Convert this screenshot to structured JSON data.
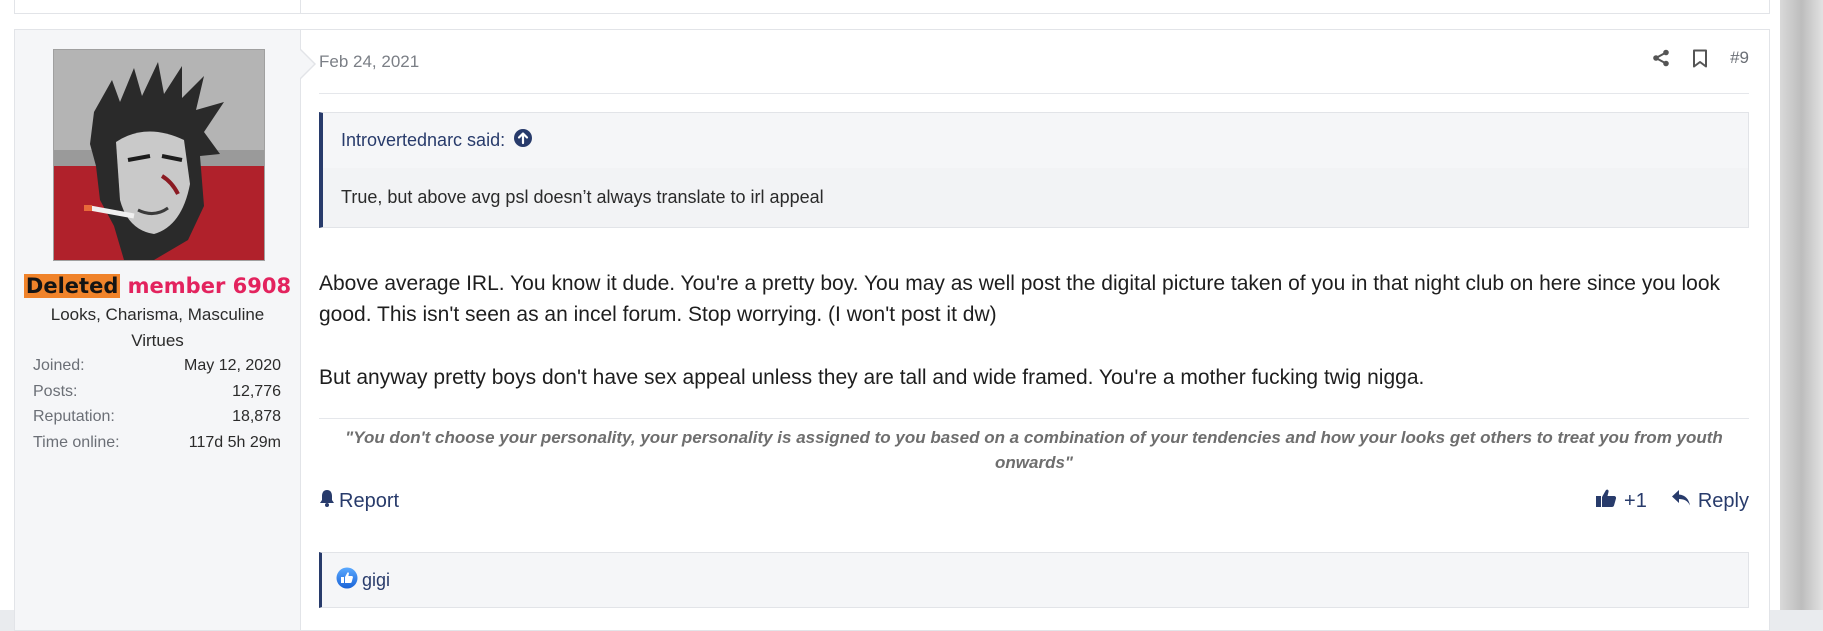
{
  "post": {
    "date": "Feb 24, 2021",
    "number": "#9",
    "user": {
      "badge": "Deleted",
      "name": "member 6908",
      "title": "Looks, Charisma, Masculine Virtues",
      "stats": [
        {
          "key": "Joined:",
          "value": "May 12, 2020"
        },
        {
          "key": "Posts:",
          "value": "12,776"
        },
        {
          "key": "Reputation:",
          "value": "18,878"
        },
        {
          "key": "Time online:",
          "value": "117d 5h 29m"
        }
      ]
    },
    "quote": {
      "author": "Introvertednarc said:",
      "text": "True, but above avg psl doesn’t always translate to irl appeal"
    },
    "message": {
      "p1": "Above average IRL. You know it dude. You're a pretty boy. You may as well post the digital picture taken of you in that night club on here since you look good. This isn't seen as an incel forum. Stop worrying. (I won't post it dw)",
      "p2": "But anyway pretty boys don't have sex appeal unless they are tall and wide framed. You're a mother fucking twig nigga."
    },
    "signature": "\"You don't choose your personality, your personality is assigned to you based on a combination of your tendencies and how your looks get others to treat you from youth onwards\"",
    "footer": {
      "report_label": "Report",
      "like_count": "+1",
      "reply_label": "Reply"
    },
    "reactions": {
      "users": "gigi"
    }
  },
  "colors": {
    "accent": "#283b6b",
    "username": "#e3235e",
    "deleted_badge": "#f0832a"
  },
  "icons": [
    "share-icon",
    "bookmark-icon",
    "arrow-up-circle-icon",
    "bell-icon",
    "thumbs-up-icon",
    "reply-icon",
    "like-reaction-icon"
  ]
}
